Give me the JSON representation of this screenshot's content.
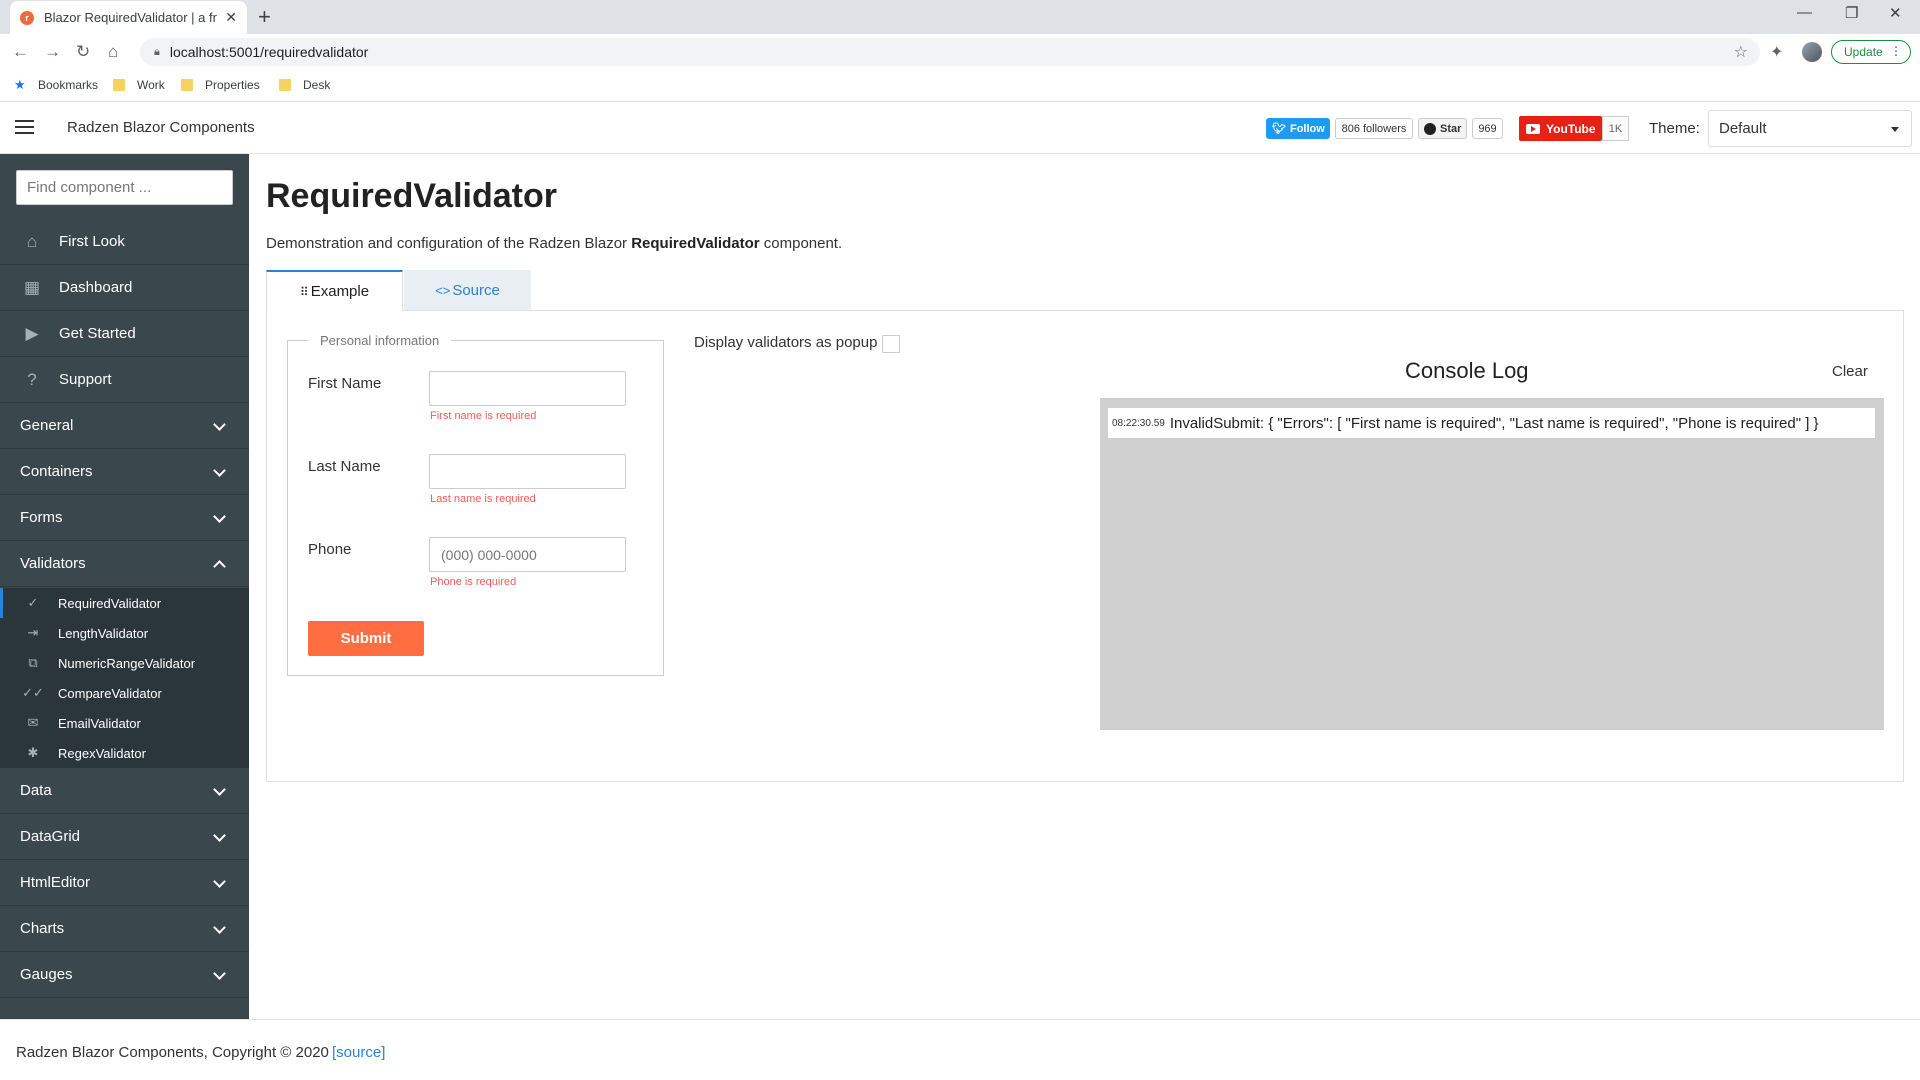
{
  "browser": {
    "tab_title": "Blazor RequiredValidator | a free",
    "tab_close": "✕",
    "new_tab": "+",
    "window_controls": {
      "minimize": "—",
      "restore": "❐",
      "close": "✕"
    },
    "url": "localhost:5001/requiredvalidator",
    "update_label": "Update",
    "bookmarks": [
      {
        "label": "Bookmarks",
        "icon": "star-icon"
      },
      {
        "label": "Work",
        "icon": "folder-icon"
      },
      {
        "label": "Properties",
        "icon": "folder-icon"
      },
      {
        "label": "Desk",
        "icon": "folder-icon"
      }
    ]
  },
  "header": {
    "title": "Radzen Blazor Components",
    "twitter_follow": "Follow",
    "twitter_followers": "806 followers",
    "github_star": "Star",
    "github_count": "969",
    "youtube_label": "YouTube",
    "youtube_count": "1K",
    "theme_label": "Theme:",
    "theme_value": "Default"
  },
  "sidebar": {
    "search_placeholder": "Find component ...",
    "top_items": [
      {
        "label": "First Look",
        "icon": "home-icon"
      },
      {
        "label": "Dashboard",
        "icon": "dashboard-icon"
      },
      {
        "label": "Get Started",
        "icon": "play-icon"
      },
      {
        "label": "Support",
        "icon": "help-icon"
      }
    ],
    "groups": [
      "General",
      "Containers",
      "Forms",
      "Validators",
      "Data",
      "DataGrid",
      "HtmlEditor",
      "Charts",
      "Gauges"
    ],
    "validators": [
      {
        "label": "RequiredValidator",
        "icon": "check-icon"
      },
      {
        "label": "LengthValidator",
        "icon": "length-icon"
      },
      {
        "label": "NumericRangeValidator",
        "icon": "numeric-icon"
      },
      {
        "label": "CompareValidator",
        "icon": "double-check-icon"
      },
      {
        "label": "EmailValidator",
        "icon": "email-icon"
      },
      {
        "label": "RegexValidator",
        "icon": "regex-icon"
      }
    ]
  },
  "main": {
    "title": "RequiredValidator",
    "desc_prefix": "Demonstration and configuration of the Radzen Blazor ",
    "desc_bold": "RequiredValidator",
    "desc_suffix": " component.",
    "tab_example": "Example",
    "tab_source": "Source",
    "form": {
      "legend": "Personal information",
      "first_name_label": "First Name",
      "first_name_value": "",
      "first_name_error": "First name is required",
      "last_name_label": "Last Name",
      "last_name_value": "",
      "last_name_error": "Last name is required",
      "phone_label": "Phone",
      "phone_placeholder": "(000) 000-0000",
      "phone_error": "Phone is required",
      "submit_label": "Submit"
    },
    "popup_label": "Display validators as popup",
    "console": {
      "title": "Console Log",
      "clear_label": "Clear",
      "entries": [
        {
          "time": "08:22:30.59",
          "message": "InvalidSubmit: { \"Errors\": [ \"First name is required\", \"Last name is required\", \"Phone is required\" ] }"
        }
      ]
    }
  },
  "footer": {
    "text": "Radzen Blazor Components, Copyright © 2020",
    "link": "[source]"
  },
  "colors": {
    "sidebar_bg": "#3a474d",
    "submenu_bg": "#2b363b",
    "accent": "#2a82d7",
    "submit": "#ff6d41",
    "error": "#f45b5b",
    "console_bg": "#cfcfcf"
  }
}
